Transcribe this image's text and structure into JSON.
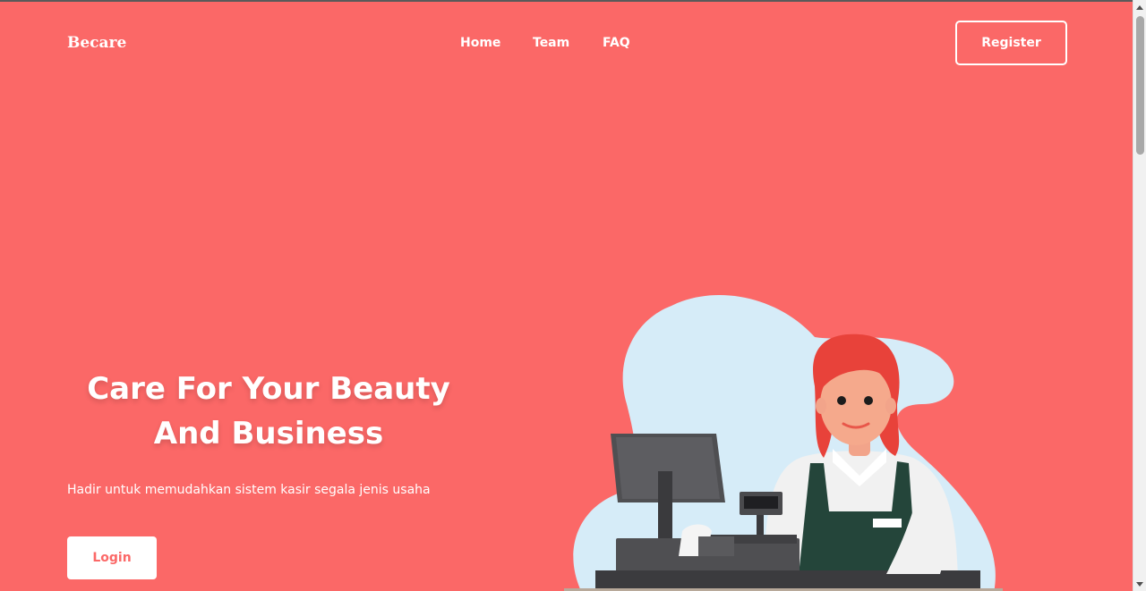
{
  "brand": "Becare",
  "nav": {
    "items": [
      {
        "label": "Home"
      },
      {
        "label": "Team"
      },
      {
        "label": "FAQ"
      }
    ],
    "register_label": "Register"
  },
  "hero": {
    "title_line1": "Care For Your Beauty",
    "title_line2": "And Business",
    "subtitle": "Hadir untuk memudahkan sistem kasir segala jenis usaha",
    "login_label": "Login"
  },
  "colors": {
    "background": "#fb6867",
    "text": "#ffffff",
    "blob": "#d6ecf8",
    "apron": "#24453a",
    "hair": "#e8423a"
  }
}
